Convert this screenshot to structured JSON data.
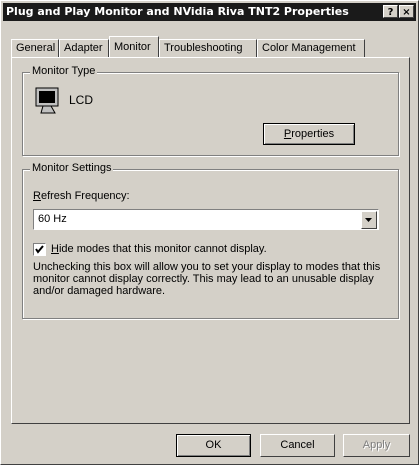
{
  "window": {
    "title": "Plug and Play Monitor and NVidia Riva TNT2 Properties",
    "help_glyph": "?",
    "close_glyph": "×"
  },
  "tabs": [
    {
      "label": "General"
    },
    {
      "label": "Adapter"
    },
    {
      "label": "Monitor"
    },
    {
      "label": "Troubleshooting"
    },
    {
      "label": "Color Management"
    }
  ],
  "monitor_type": {
    "legend": "Monitor Type",
    "name": "LCD",
    "properties_button": {
      "pre": "",
      "key": "P",
      "post": "roperties"
    }
  },
  "monitor_settings": {
    "legend": "Monitor Settings",
    "refresh_label": {
      "key": "R",
      "post": "efresh Frequency:"
    },
    "refresh_value": "60 Hz",
    "hide_modes": {
      "checked": true,
      "key": "H",
      "post": "ide modes that this monitor cannot display."
    },
    "warning": "Unchecking this box will allow you to set your display to modes that this monitor cannot display correctly. This may lead to an unusable display and/or damaged hardware."
  },
  "buttons": {
    "ok": "OK",
    "cancel": "Cancel",
    "apply": "Apply"
  }
}
